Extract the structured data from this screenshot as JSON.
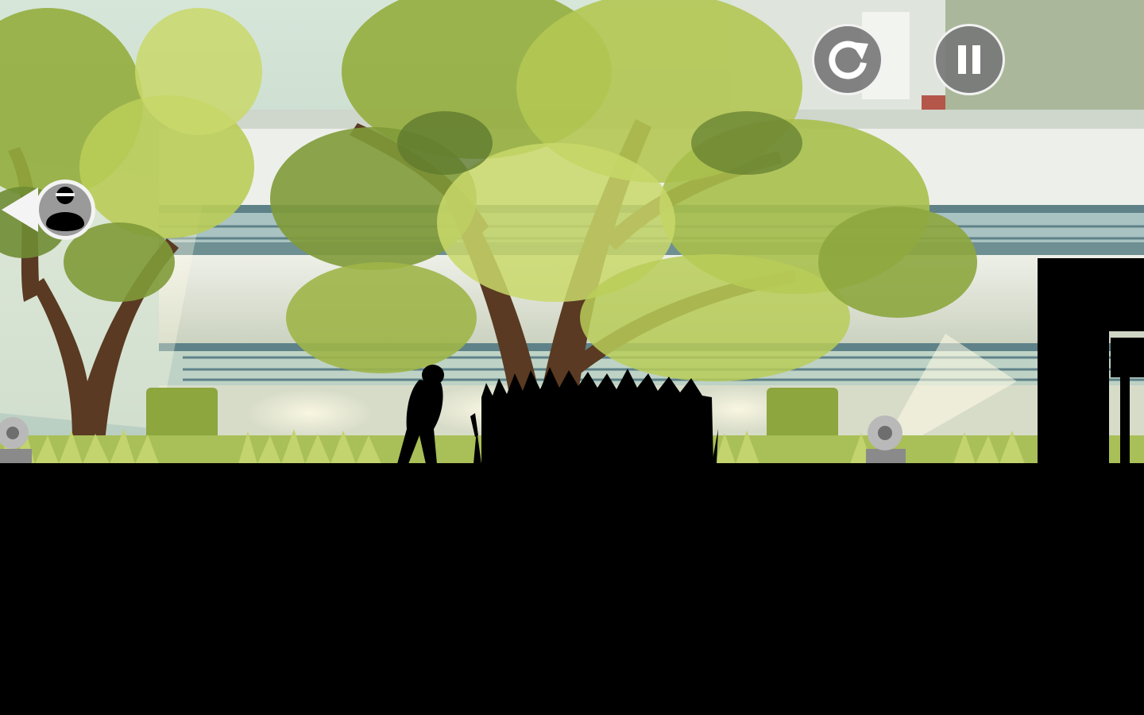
{
  "game": {
    "title": "",
    "hud": {
      "restart_icon": "restart-icon",
      "pause_icon": "pause-icon"
    },
    "indicator": {
      "icon": "chaser-indicator-icon",
      "direction": "left"
    }
  },
  "colors": {
    "sky": "#c9ddd0",
    "foliage_light": "#c9d86a",
    "foliage_mid": "#94ad3d",
    "foliage_dark": "#4f6b2a",
    "trunk": "#5a3a22",
    "building": "#e9ece4",
    "rail": "#5e8288",
    "ground": "#000000",
    "hud_button": "#7a7a7a",
    "hud_border": "#f2f2f2"
  }
}
